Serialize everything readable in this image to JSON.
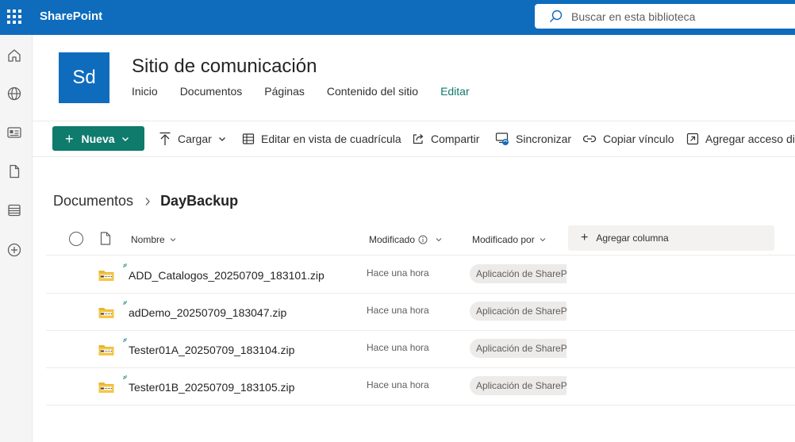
{
  "app": {
    "brand": "SharePoint"
  },
  "search": {
    "placeholder": "Buscar en esta biblioteca"
  },
  "site": {
    "logo_text": "Sd",
    "title": "Sitio de comunicación",
    "nav": [
      "Inicio",
      "Documentos",
      "Páginas",
      "Contenido del sitio",
      "Editar"
    ]
  },
  "commands": {
    "new": "Nueva",
    "upload": "Cargar",
    "grid_edit": "Editar en vista de cuadrícula",
    "share": "Compartir",
    "sync": "Sincronizar",
    "copy_link": "Copiar vínculo",
    "add_shortcut": "Agregar acceso dir"
  },
  "breadcrumb": {
    "root": "Documentos",
    "current": "DayBackup"
  },
  "columns": {
    "name": "Nombre",
    "modified": "Modificado",
    "modified_by": "Modificado por",
    "add_column": "Agregar columna"
  },
  "files": [
    {
      "name": "ADD_Catalogos_20250709_183101.zip",
      "modified": "Hace una hora",
      "modified_by": "Aplicación de SharePoint"
    },
    {
      "name": "adDemo_20250709_183047.zip",
      "modified": "Hace una hora",
      "modified_by": "Aplicación de SharePoint"
    },
    {
      "name": "Tester01A_20250709_183104.zip",
      "modified": "Hace una hora",
      "modified_by": "Aplicación de SharePoint"
    },
    {
      "name": "Tester01B_20250709_183105.zip",
      "modified": "Hace una hora",
      "modified_by": "Aplicación de SharePoint"
    }
  ],
  "colors": {
    "header_blue": "#0f6cbd",
    "accent_teal": "#0f7b6c"
  },
  "icons": {
    "rail": [
      "home-icon",
      "globe-icon",
      "news-icon",
      "document-icon",
      "list-icon",
      "add-circle-icon"
    ]
  }
}
